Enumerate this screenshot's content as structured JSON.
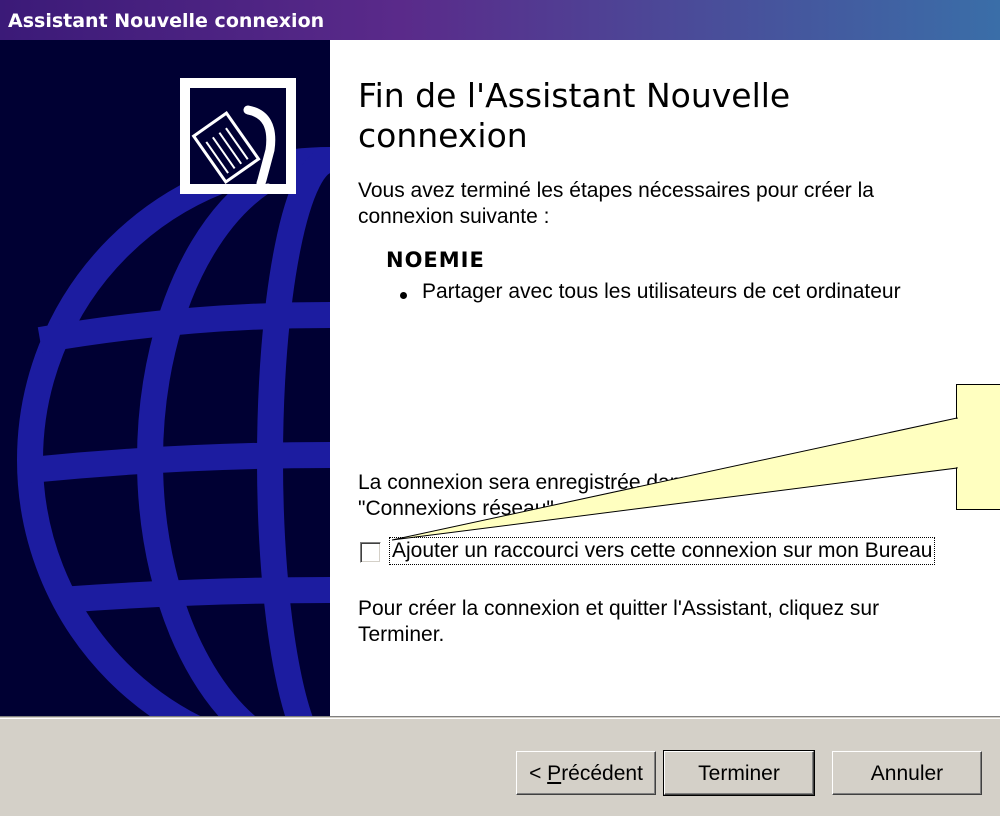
{
  "window": {
    "title": "Assistant Nouvelle connexion"
  },
  "content": {
    "heading": "Fin de l'Assistant Nouvelle connexion",
    "intro": "Vous avez terminé les étapes nécessaires pour créer la connexion suivante :",
    "connection_name": "NOEMIE",
    "bullets": [
      "Partager avec tous les utilisateurs de cet ordinateur"
    ],
    "saved_info": "La connexion sera enregistrée dans le dossier \"Connexions réseau\"",
    "shortcut_checkbox": {
      "label": "Ajouter un raccourci vers cette connexion sur mon Bureau",
      "checked": false
    },
    "finish_info": "Pour créer la connexion et quitter l'Assistant, cliquez sur Terminer."
  },
  "buttons": {
    "back": {
      "label_pre": "< ",
      "label_accel": "P",
      "label_rest": "récédent"
    },
    "finish": "Terminer",
    "cancel": "Annuler"
  },
  "icons": {
    "wizard_icon": "network-cable-icon"
  },
  "colors": {
    "sidebar_bg": "#000033",
    "globe": "#1a1a8c",
    "title_start": "#3b1a78",
    "title_end": "#3a6ea8",
    "callout_bg": "#ffffc0"
  }
}
